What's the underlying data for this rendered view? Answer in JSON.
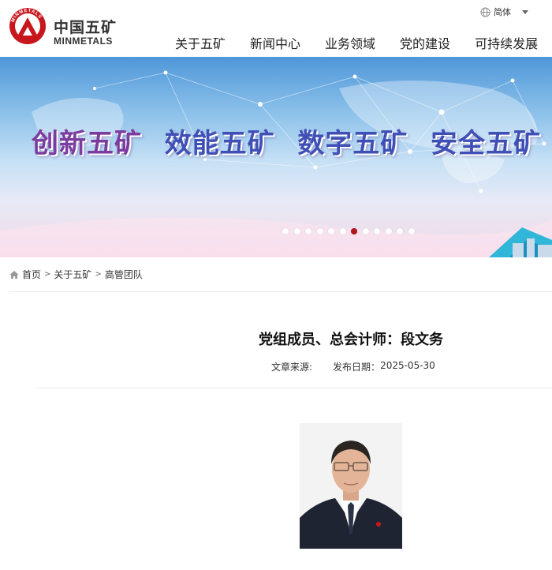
{
  "header": {
    "brand_cn": "中国五矿",
    "brand_en": "MINMETALS",
    "logo_text": "MINMETALS",
    "language": "简体"
  },
  "nav": [
    "关于五矿",
    "新闻中心",
    "业务领域",
    "党的建设",
    "可持续发展"
  ],
  "banner": {
    "slogans": [
      "创新五矿",
      "效能五矿",
      "数字五矿",
      "安全五矿"
    ],
    "dot_count": 12,
    "active_dot": 6
  },
  "breadcrumb": [
    "首页",
    "关于五矿",
    "高管团队"
  ],
  "article": {
    "title": "党组成员、总会计师：段文务",
    "source_label": "文章来源:",
    "date_label": "发布日期：",
    "date": "2025-05-30"
  },
  "colors": {
    "accent_red": "#b0161c",
    "slogan_purple": "#7c3b9e",
    "slogan_blue": "#3f4fb5"
  }
}
